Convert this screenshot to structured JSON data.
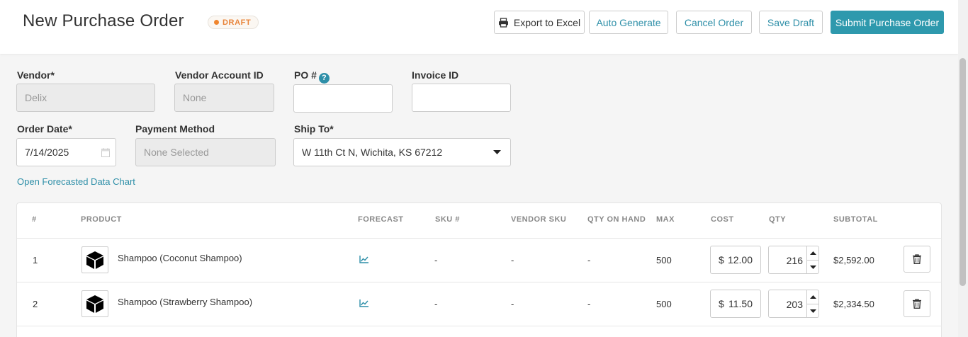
{
  "header": {
    "title": "New Purchase Order",
    "status_badge": "DRAFT",
    "buttons": {
      "export": "Export to Excel",
      "auto_generate": "Auto Generate",
      "cancel": "Cancel Order",
      "save_draft": "Save Draft",
      "submit": "Submit Purchase Order"
    },
    "colors": {
      "accent": "#2e99ad",
      "draft": "#f0852d"
    }
  },
  "form": {
    "vendor": {
      "label": "Vendor*",
      "value": "Delix"
    },
    "vendor_account_id": {
      "label": "Vendor Account ID",
      "value": "None"
    },
    "po_number": {
      "label": "PO #",
      "help": "?",
      "value": ""
    },
    "invoice_id": {
      "label": "Invoice ID",
      "value": ""
    },
    "order_date": {
      "label": "Order Date*",
      "value": "7/14/2025",
      "icon": "calendar-icon"
    },
    "payment_method": {
      "label": "Payment Method",
      "value": "None Selected"
    },
    "ship_to": {
      "label": "Ship To*",
      "value": "W 11th Ct N, Wichita, KS 67212"
    },
    "forecast_link": "Open Forecasted Data Chart"
  },
  "table": {
    "columns": [
      "#",
      "PRODUCT",
      "FORECAST",
      "SKU #",
      "VENDOR SKU",
      "QTY ON HAND",
      "MAX",
      "COST",
      "QTY",
      "SUBTOTAL"
    ],
    "currency_symbol": "$",
    "rows": [
      {
        "num": "1",
        "product": "Shampoo (Coconut Shampoo)",
        "sku": "-",
        "vendor_sku": "-",
        "qty_on_hand": "-",
        "max": "500",
        "cost": "12.00",
        "qty": "216",
        "subtotal": "$2,592.00"
      },
      {
        "num": "2",
        "product": "Shampoo (Strawberry Shampoo)",
        "sku": "-",
        "vendor_sku": "-",
        "qty_on_hand": "-",
        "max": "500",
        "cost": "11.50",
        "qty": "203",
        "subtotal": "$2,334.50"
      }
    ]
  }
}
